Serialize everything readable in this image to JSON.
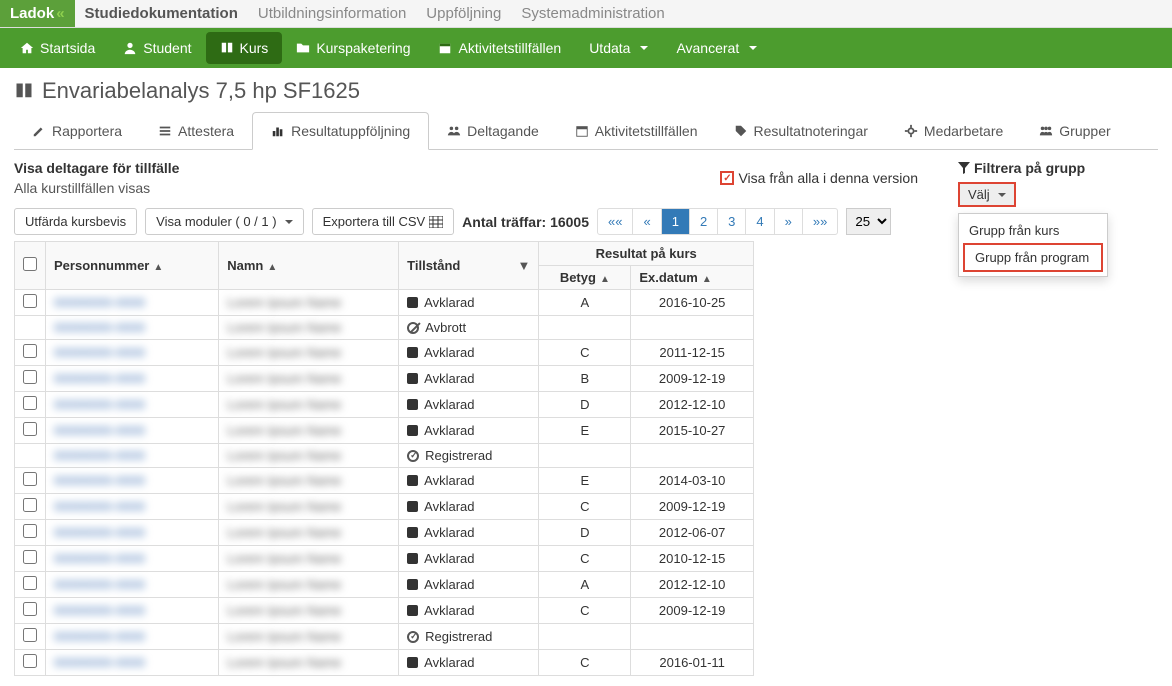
{
  "brand": "Ladok",
  "topTabs": [
    "Studiedokumentation",
    "Utbildningsinformation",
    "Uppföljning",
    "Systemadministration"
  ],
  "greenNav": {
    "home": "Startsida",
    "student": "Student",
    "course": "Kurs",
    "packaging": "Kurspaketering",
    "activities": "Aktivitetstillfällen",
    "output": "Utdata",
    "advanced": "Avancerat"
  },
  "pageTitle": "Envariabelanalys 7,5 hp SF1625",
  "courseTabs": {
    "report": "Rapportera",
    "attest": "Attestera",
    "results": "Resultatuppföljning",
    "participation": "Deltagande",
    "activities": "Aktivitetstillfällen",
    "notes": "Resultatnoteringar",
    "staff": "Medarbetare",
    "groups": "Grupper"
  },
  "subhead": "Visa deltagare för tillfälle",
  "subtext": "Alla kurstillfällen visas",
  "versionCheckLabel": "Visa från alla i denna version",
  "toolbar": {
    "issueCert": "Utfärda kursbevis",
    "showModules": "Visa moduler ( 0 / 1 )",
    "exportCsv": "Exportera till CSV",
    "hitsLabel": "Antal träffar: 16005"
  },
  "pager": {
    "first": "««",
    "prev": "«",
    "pages": [
      "1",
      "2",
      "3",
      "4"
    ],
    "next": "»",
    "last": "»»",
    "pageSize": "25"
  },
  "tableHeaders": {
    "group": "Resultat på kurs",
    "personnummer": "Personnummer",
    "namn": "Namn",
    "tillstand": "Tillstånd",
    "betyg": "Betyg",
    "exdatum": "Ex.datum"
  },
  "filter": {
    "title": "Filtrera på grupp",
    "select": "Välj",
    "opt1": "Grupp från kurs",
    "opt2": "Grupp från program"
  },
  "rows": [
    {
      "chk": true,
      "status": "avklarad",
      "statusLabel": "Avklarad",
      "betyg": "A",
      "datum": "2016-10-25"
    },
    {
      "chk": false,
      "status": "avbrott",
      "statusLabel": "Avbrott",
      "betyg": "",
      "datum": ""
    },
    {
      "chk": true,
      "status": "avklarad",
      "statusLabel": "Avklarad",
      "betyg": "C",
      "datum": "2011-12-15"
    },
    {
      "chk": true,
      "status": "avklarad",
      "statusLabel": "Avklarad",
      "betyg": "B",
      "datum": "2009-12-19"
    },
    {
      "chk": true,
      "status": "avklarad",
      "statusLabel": "Avklarad",
      "betyg": "D",
      "datum": "2012-12-10"
    },
    {
      "chk": true,
      "status": "avklarad",
      "statusLabel": "Avklarad",
      "betyg": "E",
      "datum": "2015-10-27"
    },
    {
      "chk": false,
      "status": "registrerad",
      "statusLabel": "Registrerad",
      "betyg": "",
      "datum": ""
    },
    {
      "chk": true,
      "status": "avklarad",
      "statusLabel": "Avklarad",
      "betyg": "E",
      "datum": "2014-03-10"
    },
    {
      "chk": true,
      "status": "avklarad",
      "statusLabel": "Avklarad",
      "betyg": "C",
      "datum": "2009-12-19"
    },
    {
      "chk": true,
      "status": "avklarad",
      "statusLabel": "Avklarad",
      "betyg": "D",
      "datum": "2012-06-07"
    },
    {
      "chk": true,
      "status": "avklarad",
      "statusLabel": "Avklarad",
      "betyg": "C",
      "datum": "2010-12-15"
    },
    {
      "chk": true,
      "status": "avklarad",
      "statusLabel": "Avklarad",
      "betyg": "A",
      "datum": "2012-12-10"
    },
    {
      "chk": true,
      "status": "avklarad",
      "statusLabel": "Avklarad",
      "betyg": "C",
      "datum": "2009-12-19"
    },
    {
      "chk": true,
      "status": "registrerad",
      "statusLabel": "Registrerad",
      "betyg": "",
      "datum": ""
    },
    {
      "chk": true,
      "status": "avklarad",
      "statusLabel": "Avklarad",
      "betyg": "C",
      "datum": "2016-01-11"
    }
  ]
}
